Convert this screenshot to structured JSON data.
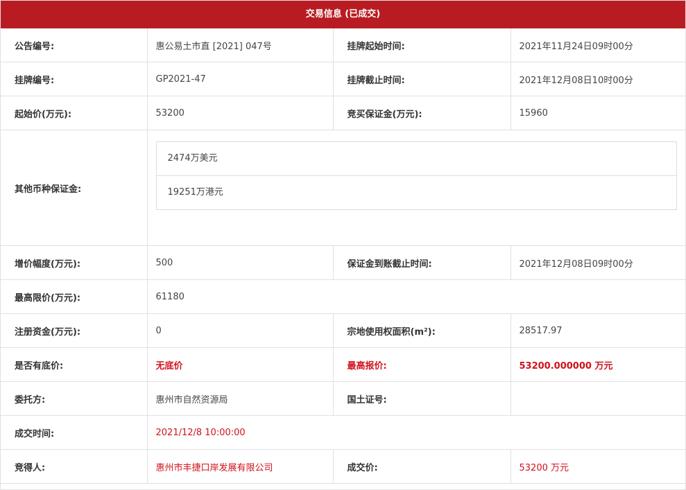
{
  "header": {
    "title": "交易信息 (已成交)"
  },
  "rows": {
    "notice_no": {
      "label": "公告编号:",
      "value": "惠公易土市直 [2021] 047号"
    },
    "listing_start": {
      "label": "挂牌起始时间:",
      "value": "2021年11月24日09时00分"
    },
    "listing_no": {
      "label": "挂牌编号:",
      "value": "GP2021-47"
    },
    "listing_end": {
      "label": "挂牌截止时间:",
      "value": "2021年12月08日10时00分"
    },
    "start_price": {
      "label": "起始价(万元):",
      "value": "53200"
    },
    "deposit": {
      "label": "竞买保证金(万元):",
      "value": "15960"
    },
    "other_currency": {
      "label": "其他币种保证金:",
      "items": [
        "2474万美元",
        "19251万港元"
      ]
    },
    "increment": {
      "label": "增价幅度(万元):",
      "value": "500"
    },
    "deposit_deadline": {
      "label": "保证金到账截止时间:",
      "value": "2021年12月08日09时00分"
    },
    "max_price": {
      "label": "最高限价(万元):",
      "value": "61180"
    },
    "reg_capital": {
      "label": "注册资金(万元):",
      "value": "0"
    },
    "land_area": {
      "label": "宗地使用权面积(m²):",
      "value": "28517.97"
    },
    "reserve": {
      "label": "是否有底价:",
      "value": "无底价"
    },
    "top_bid": {
      "label": "最高报价:",
      "value": "53200.000000 万元"
    },
    "entrust": {
      "label": "委托方:",
      "value": "惠州市自然资源局"
    },
    "land_cert": {
      "label": "国土证号:",
      "value": ""
    },
    "deal_time": {
      "label": "成交时间:",
      "value": "2021/12/8 10:00:00"
    },
    "winner": {
      "label": "竞得人:",
      "value": "惠州市丰捷口岸发展有限公司"
    },
    "deal_price": {
      "label": "成交价:",
      "value": "53200 万元"
    }
  },
  "colors": {
    "header_bg": "#b81c22",
    "highlight": "#d0121b"
  }
}
